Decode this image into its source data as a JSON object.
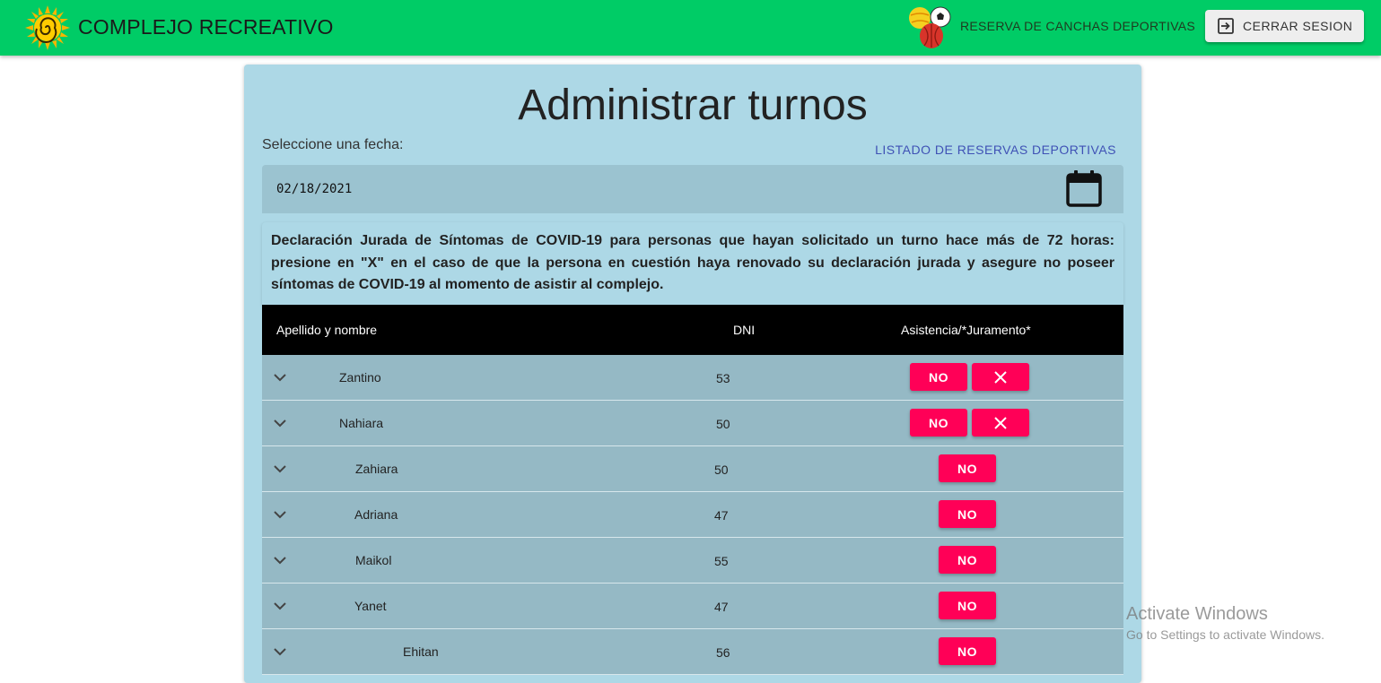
{
  "header": {
    "title": "COMPLEJO RECREATIVO",
    "nav_link": "RESERVA DE CANCHAS DEPORTIVAS",
    "logout_label": "CERRAR SESION",
    "brand_color": "#00cc66"
  },
  "main": {
    "title": "Administrar turnos",
    "date_label": "Seleccione una fecha:",
    "list_link": "LISTADO DE RESERVAS DEPORTIVAS",
    "date_value": "02/18/2021",
    "notice": "Declaración Jurada de Síntomas de COVID-19 para personas que hayan solicitado un turno hace más de 72 horas: presione en \"X\" en el caso de que la persona en cuestión haya renovado su declaración jurada y asegure no poseer síntomas de COVID-19 al momento de asistir al complejo.",
    "columns": [
      "Apellido y nombre",
      "DNI",
      "Asistencia/*Juramento*"
    ],
    "rows": [
      {
        "name": "Zantino",
        "dni": "53",
        "attendance": "NO",
        "oath_button": true
      },
      {
        "name": "Nahiara",
        "dni": "50",
        "attendance": "NO",
        "oath_button": true
      },
      {
        "name": "Zahiara",
        "dni": "50",
        "attendance": "NO",
        "oath_button": false
      },
      {
        "name": "Adriana",
        "dni": "47",
        "attendance": "NO",
        "oath_button": false
      },
      {
        "name": "Maikol",
        "dni": "55",
        "attendance": "NO",
        "oath_button": false
      },
      {
        "name": "Yanet",
        "dni": "47",
        "attendance": "NO",
        "oath_button": false
      },
      {
        "name": "Ehitan",
        "dni": "56",
        "attendance": "NO",
        "oath_button": false
      }
    ],
    "accent_color": "#ff0057"
  },
  "watermark": {
    "title": "Activate Windows",
    "subtitle": "Go to Settings to activate Windows."
  }
}
